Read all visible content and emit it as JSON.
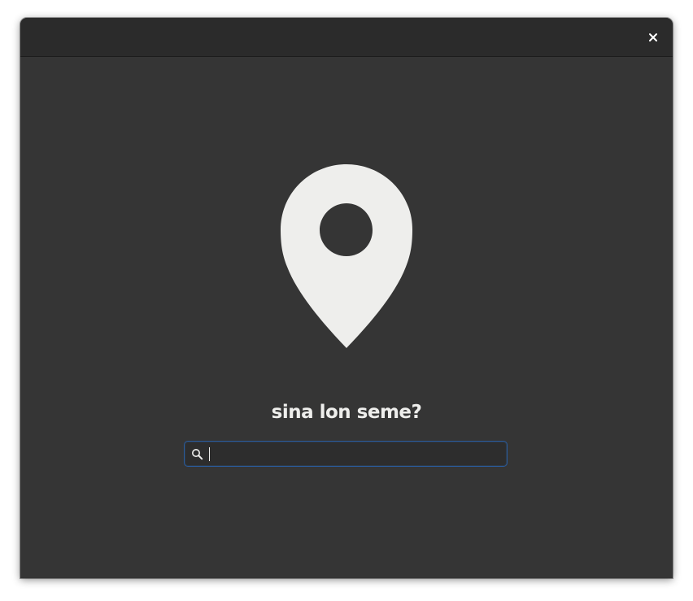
{
  "window": {
    "close_glyph": "×"
  },
  "main": {
    "title": "sina lon seme?",
    "search": {
      "value": "",
      "placeholder": ""
    }
  },
  "icons": {
    "close": "close-icon",
    "pin": "map-pin-icon",
    "search": "search-icon"
  },
  "colors": {
    "background": "#353535",
    "headerbar": "#2b2b2b",
    "foreground": "#eeeeec",
    "entry_focus": "#2a5a9a"
  }
}
